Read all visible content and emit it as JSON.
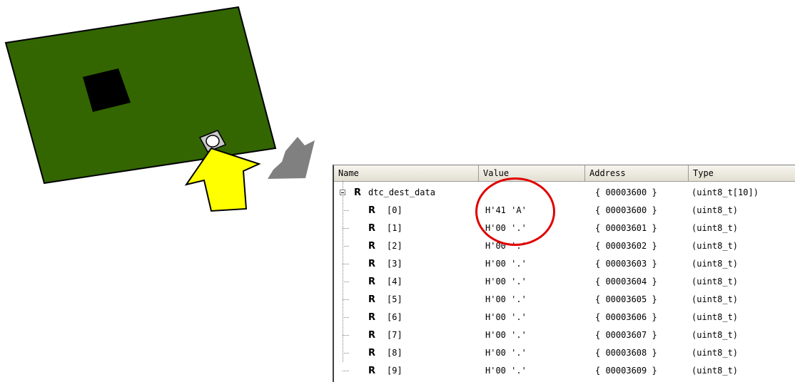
{
  "watch": {
    "columns": [
      "Name",
      "Value",
      "Address",
      "Type"
    ],
    "root": {
      "name": "dtc_dest_data",
      "value": "",
      "address": "{ 00003600 }",
      "type": "(uint8_t[10])"
    },
    "rows": [
      {
        "name": "[0]",
        "value": "H'41 'A'",
        "address": "{ 00003600 }",
        "type": "(uint8_t)"
      },
      {
        "name": "[1]",
        "value": "H'00 '.'",
        "address": "{ 00003601 }",
        "type": "(uint8_t)"
      },
      {
        "name": "[2]",
        "value": "H'00 '.'",
        "address": "{ 00003602 }",
        "type": "(uint8_t)"
      },
      {
        "name": "[3]",
        "value": "H'00 '.'",
        "address": "{ 00003603 }",
        "type": "(uint8_t)"
      },
      {
        "name": "[4]",
        "value": "H'00 '.'",
        "address": "{ 00003604 }",
        "type": "(uint8_t)"
      },
      {
        "name": "[5]",
        "value": "H'00 '.'",
        "address": "{ 00003605 }",
        "type": "(uint8_t)"
      },
      {
        "name": "[6]",
        "value": "H'00 '.'",
        "address": "{ 00003606 }",
        "type": "(uint8_t)"
      },
      {
        "name": "[7]",
        "value": "H'00 '.'",
        "address": "{ 00003607 }",
        "type": "(uint8_t)"
      },
      {
        "name": "[8]",
        "value": "H'00 '.'",
        "address": "{ 00003608 }",
        "type": "(uint8_t)"
      },
      {
        "name": "[9]",
        "value": "H'00 '.'",
        "address": "{ 00003609 }",
        "type": "(uint8_t)"
      }
    ],
    "register_icon_glyph": "R"
  },
  "colors": {
    "board": "#336600",
    "chip": "#000000",
    "pointer_arrow": "#ffff00",
    "direction_arrow": "#808080",
    "highlight": "#e00000"
  },
  "icons": [
    "circuit-board",
    "chip",
    "push-button",
    "pointer-arrow",
    "direction-arrow",
    "register-icon",
    "collapse-toggle"
  ]
}
